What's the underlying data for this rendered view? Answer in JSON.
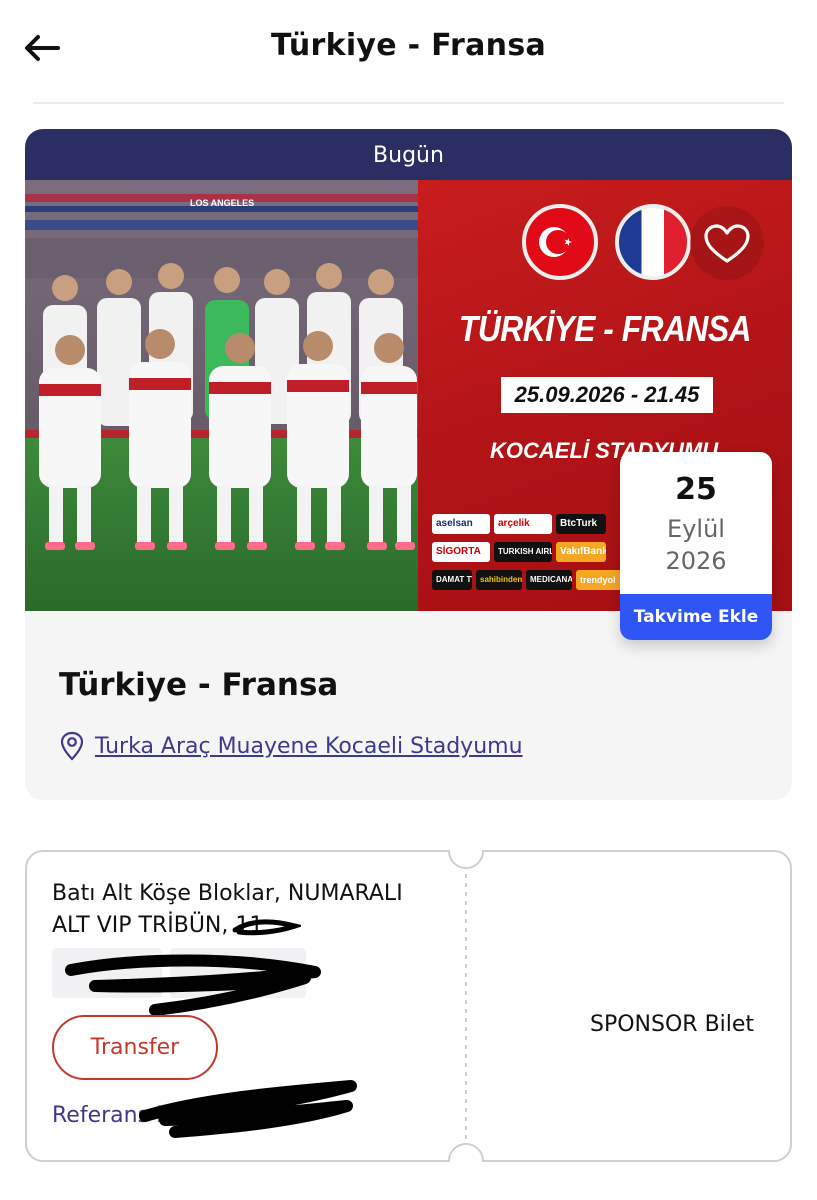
{
  "header": {
    "title": "Türkiye - Fransa",
    "back_icon": "arrow-left-icon"
  },
  "event": {
    "status_label": "Bugün",
    "banner": {
      "match_title": "TÜRKİYE - FRANSA",
      "date_time": "25.09.2026 - 21.45",
      "venue": "KOCAELİ STADYUMU",
      "stadium_sign": "LOS ANGELES",
      "sponsors": [
        "aselsan",
        "arçelik",
        "BtcTurk",
        "SİGORTA",
        "TURKISH AIRLINES",
        "VakıfBank",
        "DAMAT TWEEN",
        "sahibinden.com",
        "MEDICANA",
        "trendyol"
      ]
    },
    "date": {
      "day": "25",
      "month": "Eylül",
      "year": "2026",
      "add_to_calendar": "Takvime Ekle"
    },
    "name": "Türkiye - Fransa",
    "venue": "Turka Araç Muayene Kocaeli Stadyumu",
    "favorite_icon": "heart-icon",
    "location_icon": "location-pin-icon"
  },
  "ticket": {
    "seat": "Batı Alt Köşe Bloklar, NUMARALI ALT VIP TRİBÜN, 11",
    "transfer_label": "Transfer",
    "reference_label": "Referans N",
    "type": "SPONSOR Bilet"
  },
  "colors": {
    "status_bar": "#2b2e63",
    "calendar_button": "#2f55f4",
    "link": "#3e3a8a",
    "transfer": "#c0392b",
    "banner_red": "#b11316"
  }
}
